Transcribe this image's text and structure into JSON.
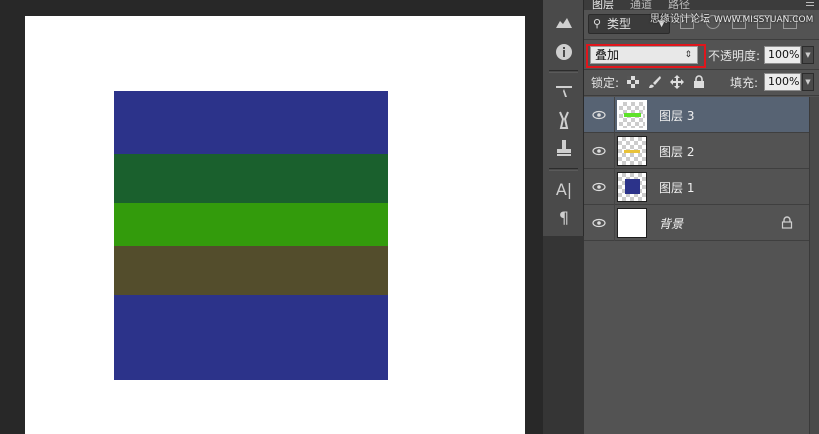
{
  "colors": {
    "workspace_bg": "#282828",
    "document_bg": "#ffffff",
    "panel_bg": "#535353",
    "selected_layer_bg": "#576373",
    "highlight_box": "#e0161c"
  },
  "canvas": {
    "bands": [
      {
        "name": "blue-top",
        "color": "#2c338a"
      },
      {
        "name": "dark-green",
        "color": "#1a602d"
      },
      {
        "name": "green",
        "color": "#339b0c"
      },
      {
        "name": "olive",
        "color": "#534d2c"
      },
      {
        "name": "blue-bottom",
        "color": "#2c338a"
      }
    ]
  },
  "tools": [
    {
      "icon": "adjust-icon"
    },
    {
      "icon": "info-icon"
    },
    {
      "icon": "brush-settings-icon"
    },
    {
      "icon": "clone-source-icon"
    },
    {
      "icon": "tool-presets-icon"
    },
    {
      "icon": "character-icon",
      "glyph": "A|"
    },
    {
      "icon": "paragraph-icon",
      "glyph": "¶"
    }
  ],
  "panel": {
    "tabs": [
      "图层",
      "通道",
      "路径"
    ],
    "watermark": "思缘设计论坛",
    "watermark_url": "WWW.MISSYUAN.COM",
    "filter": {
      "kind_label": "类型"
    },
    "blend_mode": "叠加",
    "opacity_label": "不透明度:",
    "opacity_value": "100%",
    "lock_label": "锁定:",
    "fill_label": "填充:",
    "fill_value": "100%",
    "layers": [
      {
        "name": "图层 3",
        "selected": true,
        "thumb": "green-dash",
        "mark_color": "#5ee22a"
      },
      {
        "name": "图层 2",
        "selected": false,
        "thumb": "yellow-dash",
        "mark_color": "#e8c23a"
      },
      {
        "name": "图层 1",
        "selected": false,
        "thumb": "blue-square",
        "mark_color": "#2c338a"
      },
      {
        "name": "背景",
        "selected": false,
        "thumb": "white",
        "locked": true
      }
    ]
  }
}
